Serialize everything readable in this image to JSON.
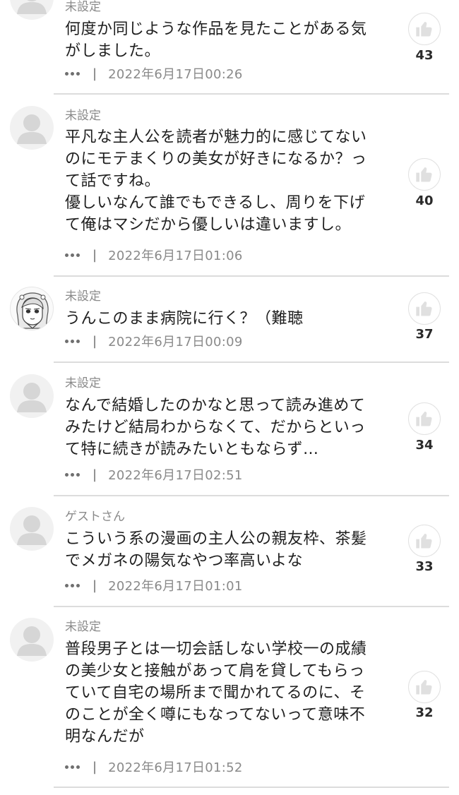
{
  "comments": [
    {
      "user": "未設定",
      "text": "何度か同じような作品を見たことがある気\nがしました。",
      "more_icon": "more-dots-icon",
      "separator": "|",
      "date": "2022年6月17日00:26",
      "likes": "43"
    },
    {
      "user": "未設定",
      "text": "平凡な主人公を読者が魅力的に感じてない\nのにモテまくりの美女が好きになるか？っ\nて話ですね。\n優しいなんて誰でもできるし、周りを下げ\nて俺はマシだから優しいは違いますし。",
      "more_icon": "more-dots-icon",
      "separator": "|",
      "date": "2022年6月17日01:06",
      "likes": "40"
    },
    {
      "user": "未設定",
      "text": "うんこのまま病院に行く？（難聴",
      "more_icon": "more-dots-icon",
      "separator": "|",
      "date": "2022年6月17日00:09",
      "likes": "37"
    },
    {
      "user": "未設定",
      "text": "なんで結婚したのかなと思って読み進めて\nみたけど結局わからなくて、だからといっ\nて特に続きが読みたいともならず…",
      "more_icon": "more-dots-icon",
      "separator": "|",
      "date": "2022年6月17日02:51",
      "likes": "34"
    },
    {
      "user": "ゲストさん",
      "text": "こういう系の漫画の主人公の親友枠、茶髪\nでメガネの陽気なやつ率高いよな",
      "more_icon": "more-dots-icon",
      "separator": "|",
      "date": "2022年6月17日01:01",
      "likes": "33"
    },
    {
      "user": "未設定",
      "text": "普段男子とは一切会話しない学校一の成績\nの美少女と接触があって肩を貸してもらっ\nていて自宅の場所まで聞かれてるのに、そ\nのことが全く噂にもなってないって意味不\n明なんだが",
      "more_icon": "more-dots-icon",
      "separator": "|",
      "date": "2022年6月17日01:52",
      "likes": "32"
    }
  ],
  "icons": {
    "avatar_default": "default-user-avatar-icon",
    "avatar_custom": "anime-girl-avatar",
    "like": "thumbs-up-icon"
  },
  "colors": {
    "text": "#1f1f1f",
    "meta": "#8a8a8a",
    "divider": "#dcdcdc",
    "icon": "#e0e0e0"
  }
}
